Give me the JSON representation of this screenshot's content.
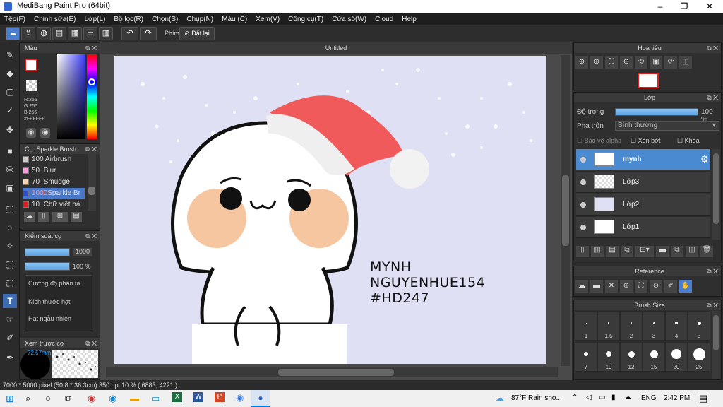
{
  "window": {
    "title": "MediBang Paint Pro (64bit)"
  },
  "menu": [
    "Tệp(F)",
    "Chỉnh sửa(E)",
    "Lớp(L)",
    "Bộ lọc(R)",
    "Chọn(S)",
    "Chụp(N)",
    "Màu (C)",
    "Xem(V)",
    "Công cụ(T)",
    "Cửa sổ(W)",
    "Cloud",
    "Help"
  ],
  "toolbar": {
    "shortcut_label": "Phím",
    "reset_label": "Đặt lại"
  },
  "color_panel": {
    "title": "Màu",
    "r": "R:255",
    "g": "G:255",
    "b": "B:255",
    "hex": "#FFFFFF"
  },
  "brush_panel": {
    "title": "Cọ: Sparkle Brush",
    "items": [
      {
        "size": "100",
        "name": "Airbrush",
        "color": "#cccccc"
      },
      {
        "size": "50",
        "name": "Blur",
        "color": "#ff9ee0"
      },
      {
        "size": "70",
        "name": "Smudge",
        "color": "#f5d6b0"
      },
      {
        "size": "1000",
        "name": "Sparkle Br",
        "color": "#3050d0"
      },
      {
        "size": "10",
        "name": "Chữ viết bả",
        "color": "#e02020"
      }
    ]
  },
  "brush_control": {
    "title": "Kiểm soát cọ",
    "size_value": "1000",
    "opacity_value": "100 %",
    "options": [
      "Cường độ phân tá",
      "Kích thước hạt",
      "Hạt ngẫu nhiên"
    ]
  },
  "brush_preview": {
    "title": "Xem trước cọ",
    "size": "72.57mm"
  },
  "canvas": {
    "tab_title": "Untitled",
    "text_lines": [
      "MYNH",
      "NGUYENHUE154",
      "#HD247"
    ]
  },
  "navigator": {
    "title": "Hoa tiêu"
  },
  "layer_panel": {
    "title": "Lớp",
    "opacity_label": "Độ trong",
    "opacity_value": "100 %",
    "opacity_fraction": 1.0,
    "blend_label": "Pha trộn",
    "blend_value": "Bình thường",
    "protect_alpha": "Bảo vệ alpha",
    "clipping": "Xén bớt",
    "lock": "Khóa",
    "layers": [
      "mynh",
      "Lớp3",
      "Lớp2",
      "Lớp1"
    ]
  },
  "reference": {
    "title": "Reference"
  },
  "brush_size": {
    "title": "Brush Size",
    "sizes": [
      "1",
      "1.5",
      "2",
      "3",
      "4",
      "5",
      "7",
      "10",
      "12",
      "15",
      "20",
      "25"
    ]
  },
  "status": {
    "text": "7000 * 5000 pixel  (50.8 * 36.3cm)  350 dpi  10 %  ( 6883, 4221 )"
  },
  "taskbar": {
    "weather": "87°F  Rain sho...",
    "lang": "ENG",
    "time": "2:42 PM"
  }
}
